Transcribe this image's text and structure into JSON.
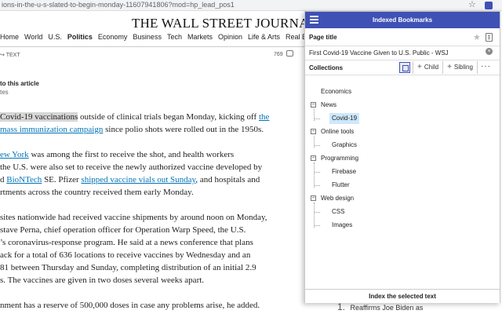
{
  "browser": {
    "url": "ions-in-the-u-s-slated-to-begin-monday-11607941806?mod=hp_lead_pos1"
  },
  "article_page": {
    "masthead": "THE WALL STREET JOURNAL.",
    "nav": [
      "Home",
      "World",
      "U.S.",
      "Politics",
      "Economy",
      "Business",
      "Tech",
      "Markets",
      "Opinion",
      "Life & Arts",
      "Real Es"
    ],
    "nav_active": "Politics",
    "share_text": "TEXT",
    "comment_count": "769",
    "share_article": "to this article",
    "share_sub": "tes",
    "paragraphs": [
      {
        "pre": "",
        "hl": "Covid-19 vaccinations",
        "mid": " outside of clinical trials began Monday, kicking off ",
        "link": "the"
      },
      {
        "pre": "",
        "link": "mass immunization campaign",
        "post": " since polio shots were rolled out in the 1950s."
      },
      {
        "pre": "",
        "link": "ew York",
        "post": " was among the first to receive the shot, and health workers"
      },
      {
        "pre": "the U.S. were also set to receive the newly authorized vaccine developed by",
        "link": "",
        "post": ""
      },
      {
        "pre": "d ",
        "link": "BioNTech",
        "mid": " SE. Pfizer ",
        "link2": "shipped vaccine vials out Sunday",
        "post": ", and hospitals and"
      },
      {
        "pre": "rtments across the country received them early Monday.",
        "link": "",
        "post": ""
      },
      {
        "pre": "sites nationwide had received vaccine shipments by around noon on Monday,",
        "link": "",
        "post": ""
      },
      {
        "pre": "stave Perna, chief operation officer for Operation Warp Speed, the U.S.",
        "link": "",
        "post": ""
      },
      {
        "pre": "’s coronavirus-response program. He said at a news conference that plans",
        "link": "",
        "post": ""
      },
      {
        "pre": "ack for a total of 636 locations to receive vaccines by Wednesday and an",
        "link": "",
        "post": ""
      },
      {
        "pre": "81 between Thursday and Sunday, completing distribution of an initial 2.9",
        "link": "",
        "post": ""
      },
      {
        "pre": "s. The vaccines are given in two doses several weeks apart.",
        "link": "",
        "post": ""
      },
      {
        "pre": "nment has a reserve of 500,000 doses in case any problems arise, he added.",
        "link": "",
        "post": ""
      }
    ],
    "sidebar_peek_num": "1.",
    "sidebar_peek_text": "Reaffirms Joe Biden as"
  },
  "popup": {
    "title": "Indexed Bookmarks",
    "page_title_label": "Page title",
    "page_title_value": "First Covid-19 Vaccine Given to U.S. Public - WSJ",
    "collections_label": "Collections",
    "child_label": "Child",
    "sibling_label": "Sibling",
    "more_label": "···",
    "tree": [
      {
        "label": "Economics",
        "children": []
      },
      {
        "label": "News",
        "children": [
          "Covid-19"
        ]
      },
      {
        "label": "Online tools",
        "children": [
          "Graphics"
        ]
      },
      {
        "label": "Programming",
        "children": [
          "Firebase",
          "Flutter"
        ]
      },
      {
        "label": "Web design",
        "children": [
          "CSS",
          "Images"
        ]
      }
    ],
    "selected": "Covid-19",
    "footer_button": "Index the selected text"
  },
  "icons": {
    "star": "star-icon",
    "extension": "extension-icon",
    "hamburger": "menu-icon",
    "save": "save-icon",
    "clear": "clear-icon",
    "tree_view": "tree-view-icon",
    "comment": "comment-icon"
  },
  "colors": {
    "accent": "#3f51b5",
    "link": "#0274b6",
    "selection": "#cde8fb",
    "highlight": "#d6d6d6"
  }
}
